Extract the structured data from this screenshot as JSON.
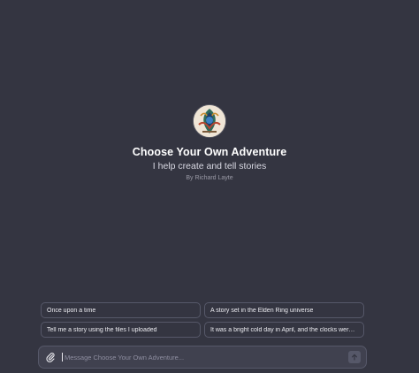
{
  "gpt": {
    "avatar_icon": "adventure-avatar-icon",
    "title": "Choose Your Own Adventure",
    "subtitle": "I help create and tell stories",
    "byline": "By Richard Layte"
  },
  "suggestions": [
    {
      "label": "Once upon a time"
    },
    {
      "label": "A story set in the Elden Ring universe"
    },
    {
      "label": "Tell me a story using the files I uploaded"
    },
    {
      "label": "It was a bright cold day in April, and the clocks were striking thirteen."
    }
  ],
  "composer": {
    "placeholder": "Message Choose Your Own Adventure...",
    "attach_icon": "paperclip-icon",
    "send_icon": "arrow-up-icon"
  },
  "colors": {
    "background": "#343541",
    "composer_bg": "#40414f",
    "border": "#565869",
    "text": "#ececf1",
    "muted": "#9a9aa6"
  }
}
